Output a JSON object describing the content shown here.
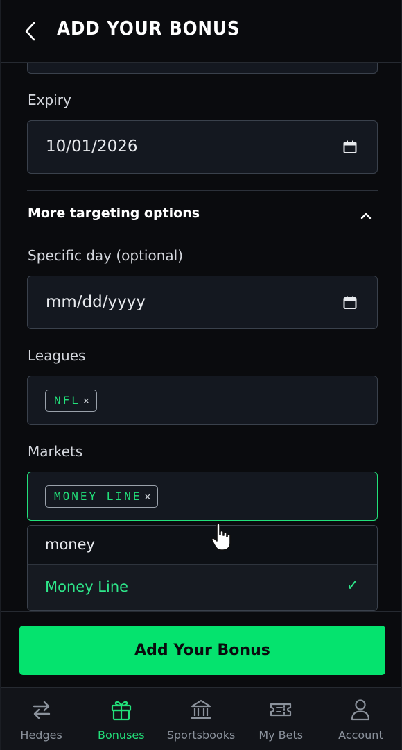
{
  "header": {
    "title": "ADD YOUR BONUS"
  },
  "form": {
    "expiry": {
      "label": "Expiry",
      "value": "10/01/2026"
    },
    "targeting": {
      "title": "More targeting options"
    },
    "specific_day": {
      "label": "Specific day (optional)",
      "placeholder": "mm/dd/yyyy"
    },
    "leagues": {
      "label": "Leagues",
      "chips": [
        {
          "text": "NFL",
          "remove": "×"
        }
      ]
    },
    "markets": {
      "label": "Markets",
      "chips": [
        {
          "text": "MONEY LINE",
          "remove": "×"
        }
      ],
      "search_value": "money",
      "options": [
        {
          "label": "Money Line",
          "check": "✓"
        }
      ]
    }
  },
  "cta": {
    "label": "Add Your Bonus"
  },
  "nav": {
    "items": [
      {
        "label": "Hedges",
        "icon": "swap-arrows-icon"
      },
      {
        "label": "Bonuses",
        "icon": "gift-icon"
      },
      {
        "label": "Sportsbooks",
        "icon": "bank-icon"
      },
      {
        "label": "My Bets",
        "icon": "ticket-icon"
      },
      {
        "label": "Account",
        "icon": "user-icon"
      }
    ],
    "active": "Bonuses"
  },
  "colors": {
    "accent": "#22e07a",
    "button": "#05e36e",
    "background": "#0a0b0e",
    "field": "#141820",
    "muted": "#8b929c"
  }
}
